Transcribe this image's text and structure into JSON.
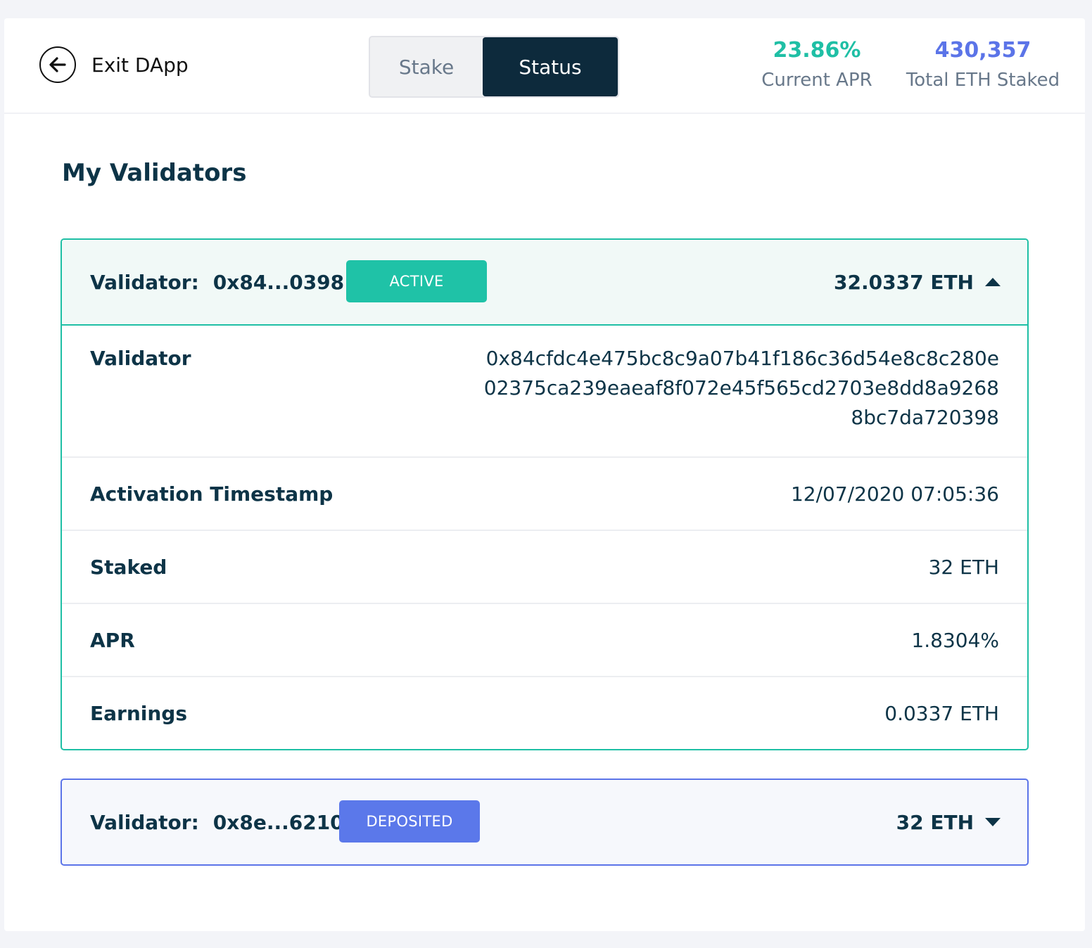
{
  "header": {
    "exit_label": "Exit DApp",
    "tabs": [
      {
        "label": "Stake",
        "active": false
      },
      {
        "label": "Status",
        "active": true
      }
    ],
    "stats": {
      "apr_value": "23.86%",
      "apr_label": "Current APR",
      "apr_color": "#1fbfa5",
      "total_value": "430,357",
      "total_label": "Total ETH Staked",
      "total_color": "#5b74e8"
    }
  },
  "main": {
    "title": "My Validators",
    "validators": [
      {
        "label": "Validator:",
        "short_address": "0x84...0398",
        "status": "ACTIVE",
        "status_color": "#1fc2a7",
        "balance": "32.0337 ETH",
        "expanded": true,
        "details": {
          "validator_label": "Validator",
          "address_lines": [
            "0x84cfdc4e475bc8c9a07b41f186c36d54e8c8c280e",
            "02375ca239eaeaf8f072e45f565cd2703e8dd8a9268",
            "8bc7da720398"
          ],
          "activation_label": "Activation Timestamp",
          "activation_value": "12/07/2020 07:05:36",
          "staked_label": "Staked",
          "staked_value": "32 ETH",
          "apr_label": "APR",
          "apr_value": "1.8304%",
          "earnings_label": "Earnings",
          "earnings_value": "0.0337 ETH"
        }
      },
      {
        "label": "Validator:",
        "short_address": "0x8e...6210",
        "status": "DEPOSITED",
        "status_color": "#5b78ea",
        "balance": "32 ETH",
        "expanded": false
      }
    ]
  }
}
